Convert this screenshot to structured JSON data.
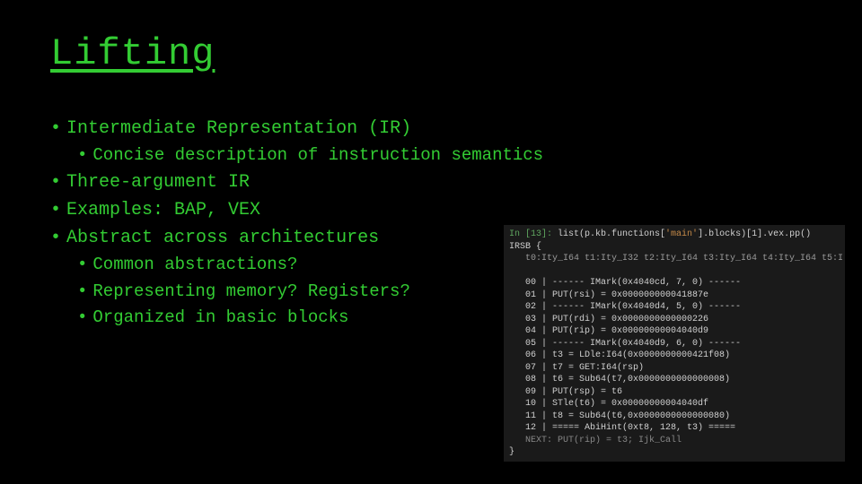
{
  "title": "Lifting",
  "bullets": [
    {
      "level": 1,
      "text": "Intermediate Representation (IR)"
    },
    {
      "level": 2,
      "text": "Concise description of instruction semantics"
    },
    {
      "level": 1,
      "text": "Three-argument IR"
    },
    {
      "level": 1,
      "text": "Examples: BAP, VEX"
    },
    {
      "level": 1,
      "text": "Abstract across architectures"
    },
    {
      "level": 2,
      "text": "Common abstractions?"
    },
    {
      "level": 2,
      "text": "Representing memory? Registers?"
    },
    {
      "level": 2,
      "text": "Organized in basic blocks"
    }
  ],
  "code": {
    "prompt_label": "In [13]:",
    "prompt_expr_pre": " list(p.kb.functions[",
    "prompt_str": "'main'",
    "prompt_expr_post": "].blocks)[1].vex.pp()",
    "header": "IRSB {",
    "types": "   t0:Ity_I64 t1:Ity_I32 t2:Ity_I64 t3:Ity_I64 t4:Ity_I64 t5:I",
    "lines": [
      "   00 | ------ IMark(0x4040cd, 7, 0) ------",
      "   01 | PUT(rsi) = 0x000000000041887e",
      "   02 | ------ IMark(0x4040d4, 5, 0) ------",
      "   03 | PUT(rdi) = 0x0000000000000226",
      "   04 | PUT(rip) = 0x00000000004040d9",
      "   05 | ------ IMark(0x4040d9, 6, 0) ------",
      "   06 | t3 = LDle:I64(0x0000000000421f08)",
      "   07 | t7 = GET:I64(rsp)",
      "   08 | t6 = Sub64(t7,0x0000000000000008)",
      "   09 | PUT(rsp) = t6",
      "   10 | STle(t6) = 0x00000000004040df",
      "   11 | t8 = Sub64(t6,0x0000000000000080)",
      "   12 | ===== AbiHint(0xt8, 128, t3) ====="
    ],
    "next": "   NEXT: PUT(rip) = t3; Ijk_Call",
    "footer": "}"
  }
}
